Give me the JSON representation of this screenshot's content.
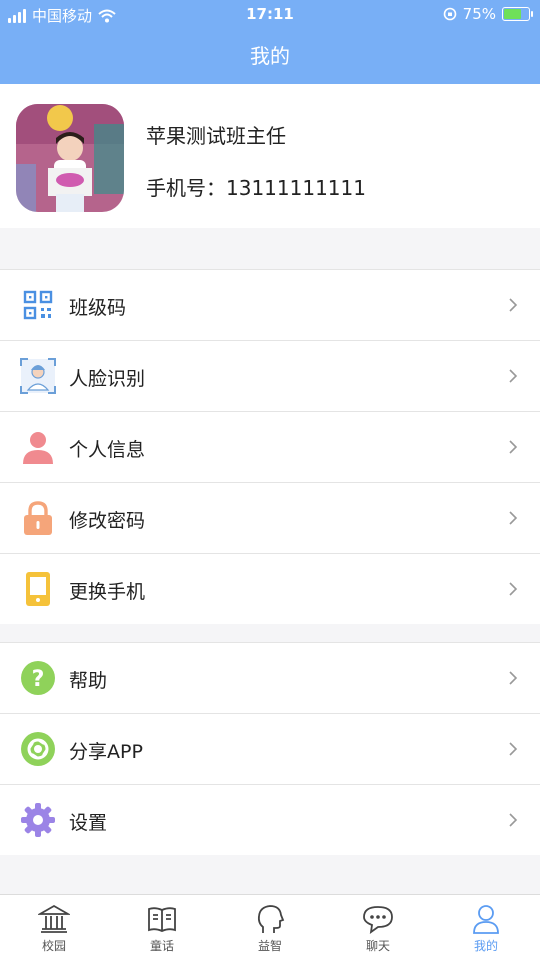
{
  "status_bar": {
    "carrier": "中国移动",
    "time": "17:11",
    "battery": "75%",
    "battery_level": 0.75
  },
  "header": {
    "title": "我的"
  },
  "profile": {
    "name": "苹果测试班主任",
    "phone": "手机号：13111111111"
  },
  "menu_group_1": [
    {
      "label": "班级码",
      "icon": "qr-code-icon"
    },
    {
      "label": "人脸识别",
      "icon": "face-recognition-icon"
    },
    {
      "label": "个人信息",
      "icon": "person-icon"
    },
    {
      "label": "修改密码",
      "icon": "lock-icon"
    },
    {
      "label": "更换手机",
      "icon": "phone-icon"
    }
  ],
  "menu_group_2": [
    {
      "label": "帮助",
      "icon": "help-icon"
    },
    {
      "label": "分享APP",
      "icon": "share-icon"
    },
    {
      "label": "设置",
      "icon": "gear-icon"
    }
  ],
  "tabs": [
    {
      "label": "校园",
      "icon": "campus-icon"
    },
    {
      "label": "童话",
      "icon": "book-icon"
    },
    {
      "label": "益智",
      "icon": "head-icon"
    },
    {
      "label": "聊天",
      "icon": "chat-icon"
    },
    {
      "label": "我的",
      "icon": "user-icon",
      "active": true
    }
  ],
  "colors": {
    "header": "#78aff6",
    "active_tab": "#5b9cf2"
  }
}
